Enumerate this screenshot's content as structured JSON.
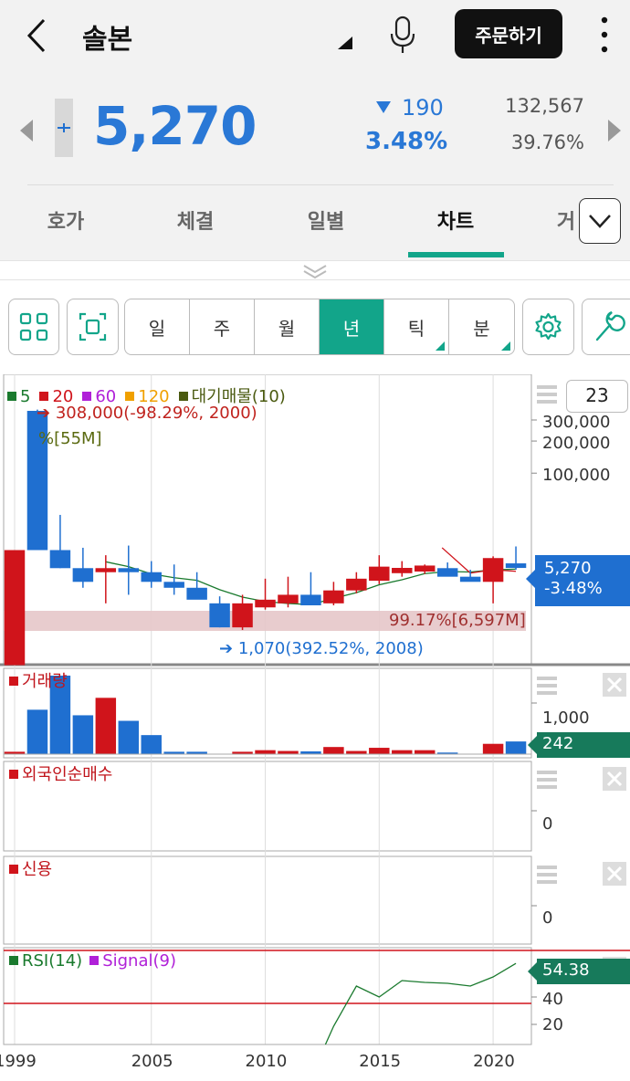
{
  "header": {
    "title": "솔본",
    "order_label": "주문하기"
  },
  "quote": {
    "price": "5,270",
    "change_amount": "190",
    "change_percent": "3.48%",
    "volume": "132,567",
    "volume_percent": "39.76%"
  },
  "tabs": [
    {
      "label": "호가"
    },
    {
      "label": "체결"
    },
    {
      "label": "일별"
    },
    {
      "label": "차트"
    },
    {
      "label": "거"
    }
  ],
  "period_buttons": [
    {
      "label": "일"
    },
    {
      "label": "주"
    },
    {
      "label": "월"
    },
    {
      "label": "년"
    },
    {
      "label": "틱"
    },
    {
      "label": "분"
    }
  ],
  "chart_panel": {
    "candle_count": "23",
    "legend": {
      "ma5": "5",
      "ma20": "20",
      "ma60": "60",
      "ma120": "120",
      "supply": "대기매물(10)"
    },
    "high_annotation": "308,000(-98.29%, 2000)",
    "low_annotation": "1,070(392.52%, 2008)",
    "supply_top": "%[55M]",
    "supply_band": "99.17%[6,597M]",
    "price_tag_value": "5,270",
    "price_tag_change": "-3.48%",
    "volume_title": "거래량",
    "volume_tag": "242",
    "foreign_title": "외국인순매수",
    "credit_title": "신용",
    "rsi_label": "RSI(14)",
    "signal_label": "Signal(9)",
    "rsi_tag": "54.38",
    "colors": {
      "up": "#d0141b",
      "down": "#1f6fd0",
      "accent": "#12a58a"
    }
  },
  "chart_data": {
    "type": "candlestick",
    "x": [
      "1999",
      "2000",
      "2001",
      "2002",
      "2003",
      "2004",
      "2005",
      "2006",
      "2007",
      "2008",
      "2009",
      "2010",
      "2011",
      "2012",
      "2013",
      "2014",
      "2015",
      "2016",
      "2017",
      "2018",
      "2019",
      "2020",
      "2021"
    ],
    "ohlc": [
      [
        400,
        8000,
        400,
        8000
      ],
      [
        300000,
        310000,
        8000,
        8000
      ],
      [
        8000,
        20000,
        5000,
        5000
      ],
      [
        5000,
        8500,
        3000,
        3500
      ],
      [
        4500,
        7000,
        2000,
        5000
      ],
      [
        5000,
        9000,
        2500,
        4500
      ],
      [
        4500,
        6000,
        3000,
        3500
      ],
      [
        3500,
        5500,
        2500,
        3000
      ],
      [
        3000,
        4500,
        2500,
        2200
      ],
      [
        2000,
        2400,
        1070,
        1070
      ],
      [
        1070,
        2500,
        1000,
        2000
      ],
      [
        1800,
        3800,
        1700,
        2200
      ],
      [
        2000,
        4000,
        1800,
        2500
      ],
      [
        2500,
        4500,
        1900,
        1900
      ],
      [
        2000,
        3500,
        1900,
        2800
      ],
      [
        2800,
        4500,
        2600,
        3800
      ],
      [
        3600,
        7000,
        3300,
        5200
      ],
      [
        4600,
        6000,
        4000,
        4800
      ],
      [
        4800,
        5500,
        4300,
        5100
      ],
      [
        5000,
        5800,
        4500,
        4000
      ],
      [
        4000,
        4800,
        3600,
        3500
      ],
      [
        3500,
        6800,
        2000,
        6500
      ],
      [
        5400,
        8800,
        4800,
        5270
      ]
    ],
    "ylim": [
      1000,
      300000
    ],
    "y_ticks": [
      "300,000",
      "200,000",
      "100,000"
    ],
    "x_ticks": [
      "1999",
      "2005",
      "2010",
      "2015",
      "2020"
    ],
    "volume_ticks": [
      "1,000"
    ],
    "foreign_ticks": [
      "0"
    ],
    "credit_ticks": [
      "0"
    ],
    "rsi_ticks": [
      "40",
      "20"
    ],
    "volume": [
      30,
      560,
      990,
      490,
      710,
      420,
      240,
      30,
      30,
      0,
      30,
      50,
      40,
      35,
      90,
      40,
      80,
      50,
      50,
      20,
      0,
      130,
      160
    ],
    "rsi": [
      null,
      null,
      null,
      null,
      null,
      null,
      null,
      null,
      null,
      null,
      null,
      null,
      null,
      null,
      20,
      42,
      36,
      45,
      44,
      43.5,
      42,
      47,
      54.38
    ]
  }
}
